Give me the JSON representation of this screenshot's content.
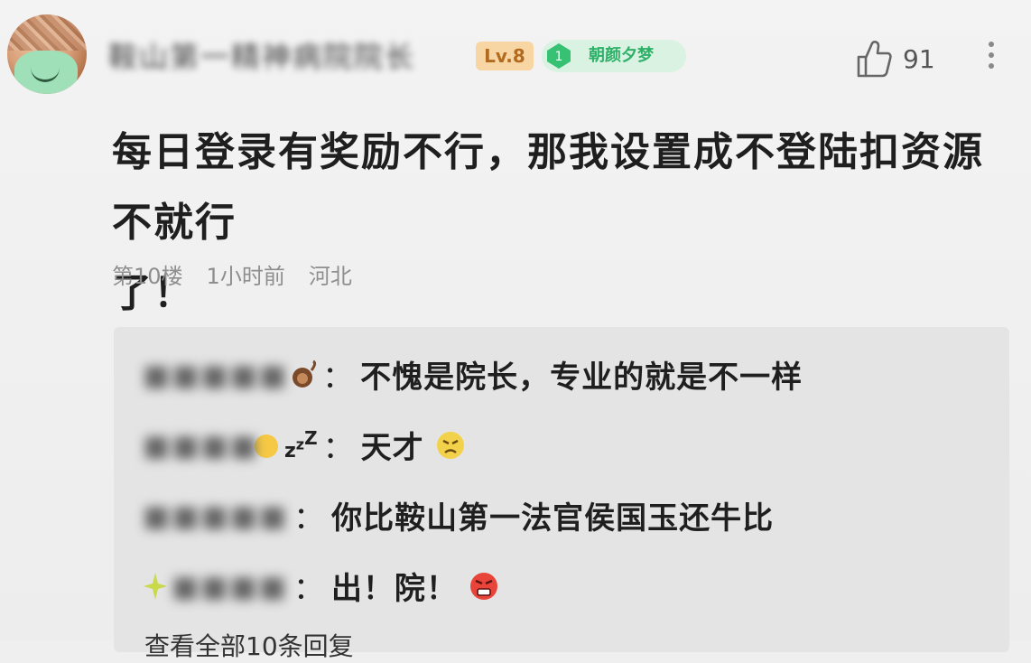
{
  "post": {
    "username": "鞍山第一精神病院院长",
    "level": "Lv.8",
    "rank_number": "1",
    "rank_title": "朝颜夕梦",
    "likes": "91",
    "content_line1": "每日登录有奖励不行，那我设置成不登陆扣资源不就行",
    "content_line2": "了！",
    "floor": "第10楼",
    "time": "1小时前",
    "location": "河北"
  },
  "replies": [
    {
      "name": "■■■■■",
      "sep": "：",
      "text": "不愧是院长，专业的就是不一样"
    },
    {
      "name": "■■■■",
      "sep": "：",
      "text": "天才"
    },
    {
      "name": "■■■■■",
      "sep": "：",
      "text": "你比鞍山第一法官侯国玉还牛比"
    },
    {
      "name": "■■■■",
      "sep": "：",
      "text": "出！院！"
    }
  ],
  "more_replies_label": "查看全部10条回复",
  "icons": {
    "like": "thumbs-up-icon",
    "more": "more-vertical-icon",
    "rank": "green-gem-icon",
    "emoji_angry_yellow": "angry-face-icon",
    "emoji_mad_red": "mad-face-icon",
    "emoji_sleep": "sleeping-face-icon",
    "emoji_monkey": "monkey-icon"
  },
  "colors": {
    "rank_green": "#2fb068",
    "level_orange": "#b26b1e",
    "meta_gray": "#8e8e8e"
  }
}
